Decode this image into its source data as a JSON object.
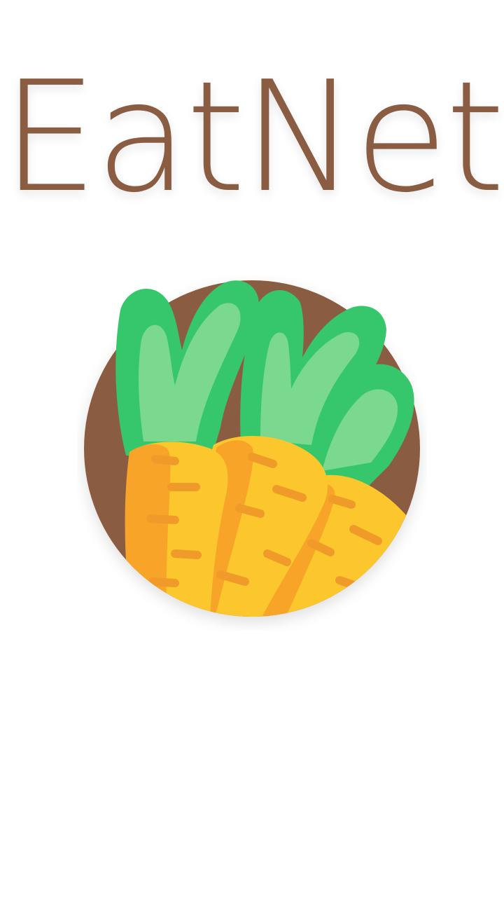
{
  "app": {
    "title": "EatNet"
  },
  "logo": {
    "icon": "carrot-bunch-icon"
  },
  "colors": {
    "title": "#8a5d43",
    "badge": "#8a5d43",
    "leaf_dark": "#36c76c",
    "leaf_light": "#7ad98f",
    "carrot_orange": "#f7a428",
    "carrot_yellow": "#fbc72c",
    "carrot_stripe": "#f09a2a"
  }
}
